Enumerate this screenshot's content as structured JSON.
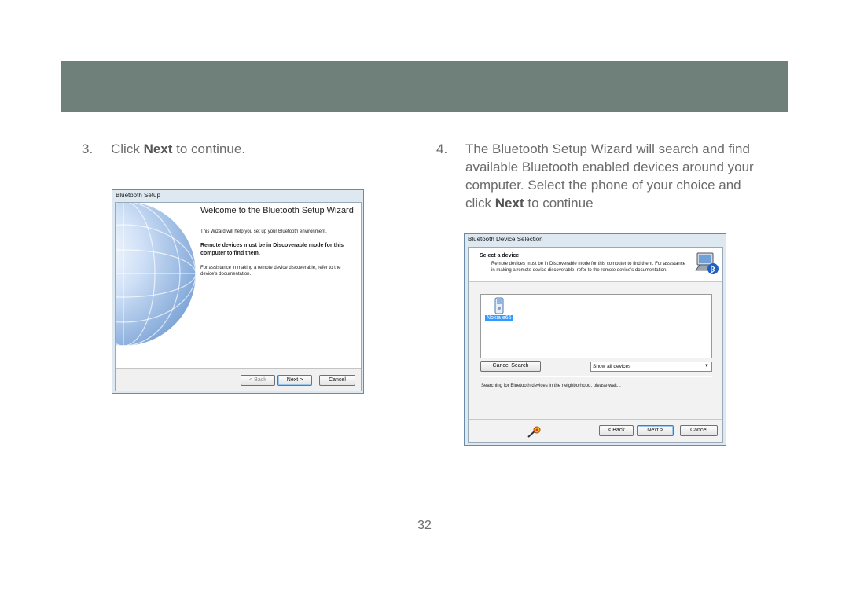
{
  "step3": {
    "number": "3.",
    "pre": "Click ",
    "bold": "Next",
    "post": " to continue."
  },
  "step4": {
    "number": "4.",
    "pre": "The Bluetooth Setup Wizard will search and find available Bluetooth enabled devices around your computer.  Select the phone of your choice and click ",
    "bold": "Next",
    "post": " to continue"
  },
  "welcome_dialog": {
    "window_title": "Bluetooth Setup",
    "heading": "Welcome to the Bluetooth Setup Wizard",
    "intro": "This Wizard will help you set up your Bluetooth environment.",
    "emphasis": "Remote devices must be in Discoverable mode for this computer to find them.",
    "assist": "For assistance in making a remote device discoverable, refer to the device's documentation.",
    "back_label": "< Back",
    "next_label": "Next >",
    "cancel_label": "Cancel"
  },
  "device_dialog": {
    "window_title": "Bluetooth Device Selection",
    "section_title": "Select a device",
    "description": "Remote devices must be in Discoverable mode for this computer to find them. For assistance in making a remote device discoverable, refer to the remote device's documentation.",
    "devices": [
      {
        "name": "Nokia e66",
        "icon": "phone-icon",
        "selected": true
      }
    ],
    "cancel_search_label": "Cancel Search",
    "filter_selected": "Show all devices",
    "status": "Searching for Bluetooth devices in the neighborhood, please wait...",
    "back_label": "< Back",
    "next_label": "Next >",
    "cancel_label": "Cancel"
  },
  "page_number": "32",
  "colors": {
    "header_bar": "#6f7f7a",
    "body_text": "#6b6b6b",
    "selection": "#3399ff"
  }
}
